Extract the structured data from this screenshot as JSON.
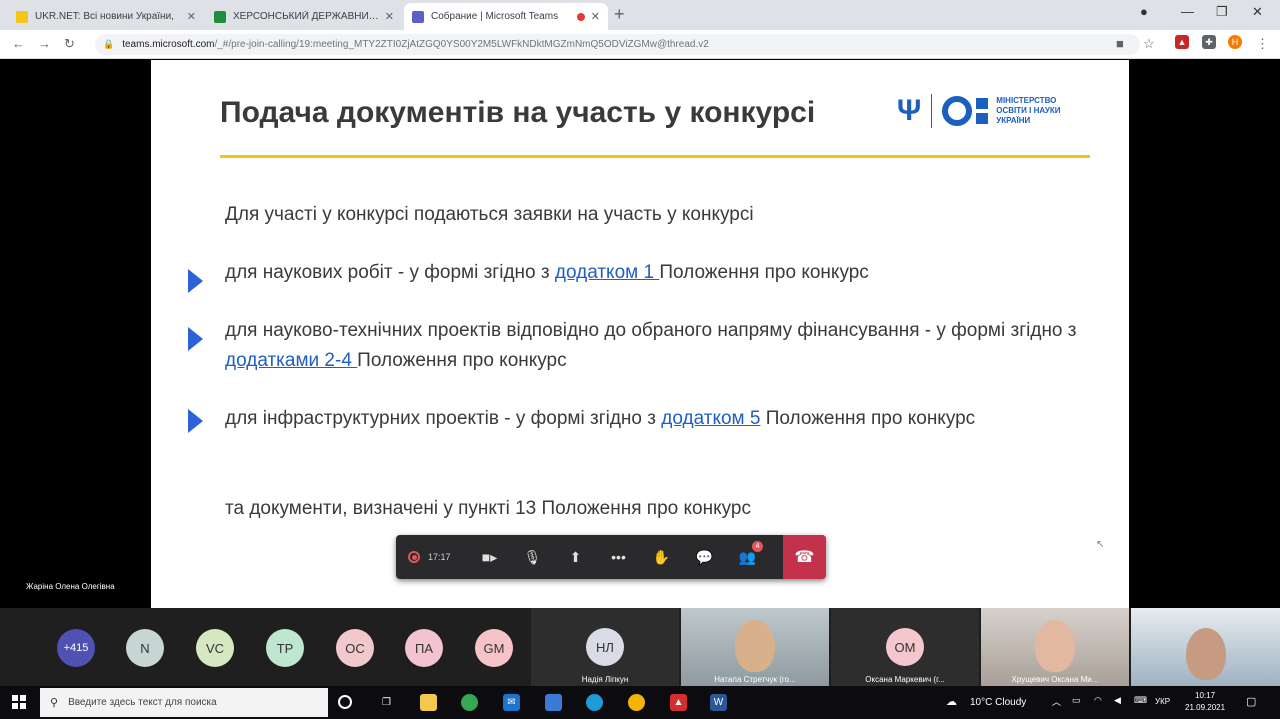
{
  "browser": {
    "tabs": [
      {
        "title": "UKR.NET: Всі новини України, ",
        "favicon_color": "#f5c518"
      },
      {
        "title": "ХЕРСОНСЬКИЙ ДЕРЖАВНИЙ А",
        "favicon_color": "#1e8e3e"
      },
      {
        "title": "Собрание | Microsoft Teams",
        "favicon_color": "#5b5fc7",
        "active": true
      }
    ],
    "new_tab": "+",
    "url_host": "teams.microsoft.com",
    "url_path": "/_#/pre-join-calling/19:meeting_MTY2ZTI0ZjAtZGQ0YS00Y2M5LWFkNDktMGZmNmQ5ODViZGMw@thread.v2",
    "profile_initial": "Н"
  },
  "slide": {
    "title": "Подача документів на участь у конкурсі",
    "logo_lines": [
      "МІНІСТЕРСТВО",
      "ОСВІТИ І НАУКИ",
      "УКРАЇНИ"
    ],
    "intro": "Для участі у конкурсі подаються заявки на участь у конкурсі",
    "items": [
      {
        "before": "для наукових робіт - у формі згідно з ",
        "link": "додатком 1 ",
        "after": "Положення про конкурс"
      },
      {
        "before": "для науково-технічних проектів відповідно до обраного напряму фінансування - у формі згідно з ",
        "link": "додатками 2-4 ",
        "after": "Положення про конкурс"
      },
      {
        "before": "для інфраструктурних проектів - у формі згідно з ",
        "link": "додатком 5",
        "after": " Положення про конкурс"
      }
    ],
    "outro": "та документи, визначені у пункті 13 Положення про конкурс"
  },
  "meeting": {
    "timer": "17:17",
    "participants_badge": "4",
    "presenter_name": "Жаріна Олена Олегівна"
  },
  "participants": {
    "overflow": "+415",
    "avatars": [
      {
        "initials": "N",
        "color": "#c7d6d3"
      },
      {
        "initials": "VC",
        "color": "#d6e8c2"
      },
      {
        "initials": "TP",
        "color": "#bfe6cf"
      },
      {
        "initials": "OC",
        "color": "#f1c9cc"
      },
      {
        "initials": "ПА",
        "color": "#f3c3cf"
      },
      {
        "initials": "GM",
        "color": "#f6c4c8"
      }
    ],
    "tiles": [
      {
        "initials": "НЛ",
        "name": "Надія Ліпкун",
        "color": "#d9dbe6"
      },
      {
        "name": "Натала Стретчук (го..."
      },
      {
        "initials": "OM",
        "name": "Оксана Маркевич (г...",
        "color": "#f3c7cd"
      },
      {
        "name": "Хрущевич Оксана Ми..."
      },
      {
        "name": ""
      }
    ]
  },
  "taskbar": {
    "search_placeholder": "Введите здесь текст для поиска",
    "weather": "10°C  Cloudy",
    "lang": "УКР",
    "time": "10:17",
    "date": "21.09.2021"
  }
}
